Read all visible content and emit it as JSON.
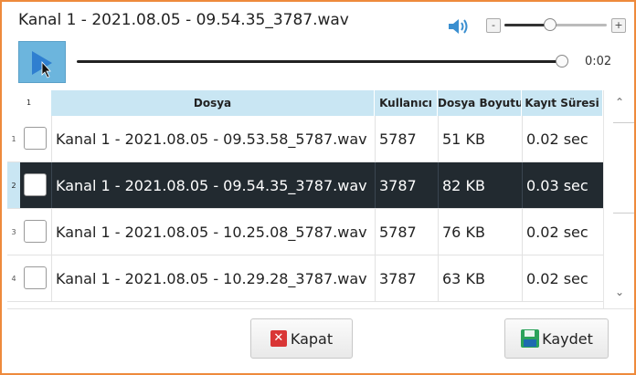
{
  "window": {
    "title": "Kanal 1 - 2021.08.05 - 09.54.35_3787.wav"
  },
  "player": {
    "volume_minus": "-",
    "volume_plus": "+",
    "volume_level": 0.45,
    "seek_progress": 1.0,
    "time": "0:02"
  },
  "table": {
    "row_num_header": "1",
    "columns": [
      "Dosya",
      "Kullanıcı",
      "Dosya Boyutu",
      "Kayıt Süresi"
    ],
    "rows": [
      {
        "num": "1",
        "dosya": "Kanal 1 - 2021.08.05 - 09.53.58_5787.wav",
        "kullanici": "5787",
        "boyut": "51 KB",
        "sure": "0.02 sec",
        "selected": false
      },
      {
        "num": "2",
        "dosya": "Kanal 1 - 2021.08.05 - 09.54.35_3787.wav",
        "kullanici": "3787",
        "boyut": "82 KB",
        "sure": "0.03 sec",
        "selected": true
      },
      {
        "num": "3",
        "dosya": "Kanal 1 - 2021.08.05 - 10.25.08_5787.wav",
        "kullanici": "5787",
        "boyut": "76 KB",
        "sure": "0.02 sec",
        "selected": false
      },
      {
        "num": "4",
        "dosya": "Kanal 1 - 2021.08.05 - 10.29.28_3787.wav",
        "kullanici": "3787",
        "boyut": "63 KB",
        "sure": "0.02 sec",
        "selected": false
      }
    ],
    "scroll_up": "ˆ",
    "scroll_down": "ˇ"
  },
  "buttons": {
    "close_label": "Kapat",
    "save_label": "Kaydet"
  },
  "colors": {
    "border": "#ee8a3c",
    "header": "#c9e6f3",
    "selected_row": "#222a30",
    "play_button": "#6cb5dd"
  }
}
